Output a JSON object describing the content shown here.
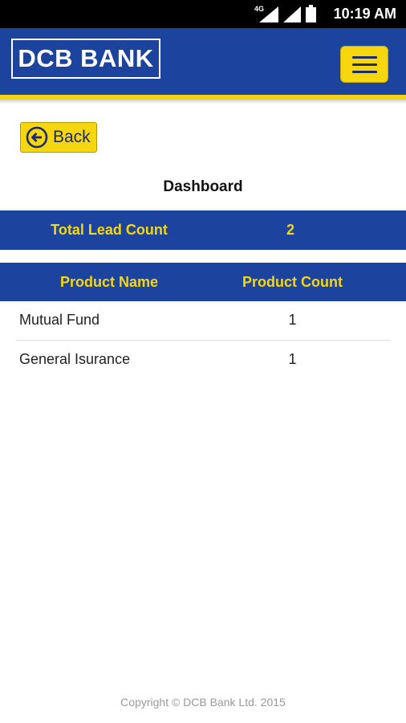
{
  "status_bar": {
    "time": "10:19 AM",
    "network": "4G",
    "icons": [
      "signal-4g-icon",
      "signal-icon",
      "battery-icon"
    ]
  },
  "header": {
    "logo_text": "DCB BANK",
    "menu_icon": "hamburger-menu-icon",
    "colors": {
      "brand_blue": "#1c449e",
      "accent_yellow": "#f6d70f"
    }
  },
  "nav": {
    "back_label": "Back",
    "back_icon": "arrow-left-circle-icon"
  },
  "page": {
    "title": "Dashboard"
  },
  "lead_summary": {
    "label": "Total Lead Count",
    "value": "2"
  },
  "product_table": {
    "headers": [
      "Product Name",
      "Product Count"
    ],
    "rows": [
      {
        "name": "Mutual Fund",
        "count": "1"
      },
      {
        "name": "General Isurance",
        "count": "1"
      }
    ]
  },
  "footer": {
    "copyright": "Copyright © DCB Bank Ltd. 2015"
  }
}
